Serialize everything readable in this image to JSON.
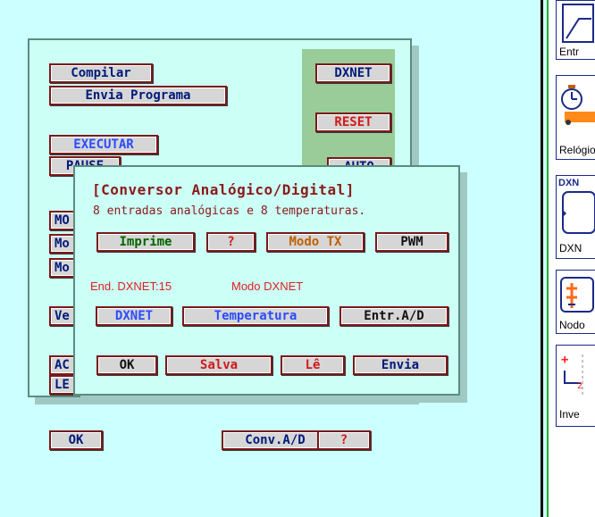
{
  "back_window": {
    "compile_label": "Compilar",
    "send_program_label": "Envia Programa",
    "execute_label": "EXECUTAR",
    "pause_label": "PAUSE",
    "dxnet_label": "DXNET",
    "reset_label": "RESET",
    "partial_labels": {
      "mo1": "MO",
      "mo2": "Mo",
      "mo3": "Mo",
      "ve": "Ve",
      "ac": "AC",
      "le": "LE",
      "aut": "AUTO"
    },
    "ok_label": "OK",
    "conv_ad_label": "Conv.A/D",
    "help_label": "?"
  },
  "dialog": {
    "title": "[Conversor Analógico/Digital]",
    "subtitle": "8 entradas analógicas e 8 temperaturas.",
    "print_label": "Imprime",
    "help_label": "?",
    "mode_tx_label": "Modo TX",
    "pwm_label": "PWM",
    "address_text": "End. DXNET:15",
    "mode_text": "Modo DXNET",
    "dxnet_label": "DXNET",
    "temperature_label": "Temperatura",
    "input_ad_label": "Entr.A/D",
    "ok_label": "OK",
    "save_label": "Salva",
    "read_label": "Lê",
    "send_label": "Envia"
  },
  "right_panel": {
    "items": [
      {
        "label": "Entr",
        "icon": "analog-input-icon"
      },
      {
        "label": "Relógio",
        "icon": "clock-icon"
      },
      {
        "label": "DXN",
        "icon": "dxnet-module-icon",
        "header": "DXN"
      },
      {
        "label": "Nodo",
        "icon": "node-icon"
      },
      {
        "label": "Inve",
        "icon": "inverter-icon"
      }
    ]
  },
  "colors": {
    "background": "#ccffff",
    "window": "#ccfff6",
    "panel_green": "#99cc99",
    "button_face": "#d6d6d6",
    "text_red": "#d01a1a",
    "text_navy": "#001a7a",
    "text_blue": "#2a4cff"
  }
}
